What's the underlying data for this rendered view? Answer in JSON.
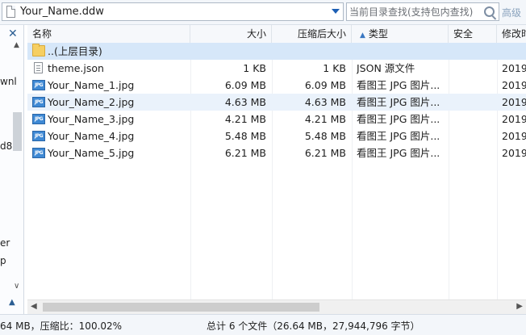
{
  "address": {
    "path": "Your_Name.ddw"
  },
  "search": {
    "placeholder": "当前目录查找(支持包内查找)",
    "advanced_label": "高级"
  },
  "left_pane": {
    "fragments": [
      "wnl",
      "d8",
      "er",
      "p"
    ]
  },
  "columns": {
    "name": "名称",
    "size": "大小",
    "packed": "压缩后大小",
    "type": "类型",
    "security": "安全",
    "modified": "修改时"
  },
  "rows": [
    {
      "name": "..(上层目录)",
      "size": "",
      "packed": "",
      "type": "",
      "modified": "",
      "icon": "folder-up-icon"
    },
    {
      "name": "theme.json",
      "size": "1 KB",
      "packed": "1 KB",
      "type": "JSON 源文件",
      "modified": "2019-",
      "icon": "json-file-icon"
    },
    {
      "name": "Your_Name_1.jpg",
      "size": "6.09 MB",
      "packed": "6.09 MB",
      "type": "看图王 JPG 图片...",
      "modified": "2019-",
      "icon": "jpg-file-icon"
    },
    {
      "name": "Your_Name_2.jpg",
      "size": "4.63 MB",
      "packed": "4.63 MB",
      "type": "看图王 JPG 图片...",
      "modified": "2019-",
      "icon": "jpg-file-icon"
    },
    {
      "name": "Your_Name_3.jpg",
      "size": "4.21 MB",
      "packed": "4.21 MB",
      "type": "看图王 JPG 图片...",
      "modified": "2019-",
      "icon": "jpg-file-icon"
    },
    {
      "name": "Your_Name_4.jpg",
      "size": "5.48 MB",
      "packed": "5.48 MB",
      "type": "看图王 JPG 图片...",
      "modified": "2019-",
      "icon": "jpg-file-icon"
    },
    {
      "name": "Your_Name_5.jpg",
      "size": "6.21 MB",
      "packed": "6.21 MB",
      "type": "看图王 JPG 图片...",
      "modified": "2019-",
      "icon": "jpg-file-icon"
    }
  ],
  "status": {
    "left": "64 MB，压缩比：100.02%",
    "right": "总计 6 个文件（26.64 MB，27,944,796 字节）"
  },
  "colors": {
    "accent": "#1c5fb4",
    "row_alt": "#eaf2fb",
    "row_selected": "#d6e7f9"
  }
}
